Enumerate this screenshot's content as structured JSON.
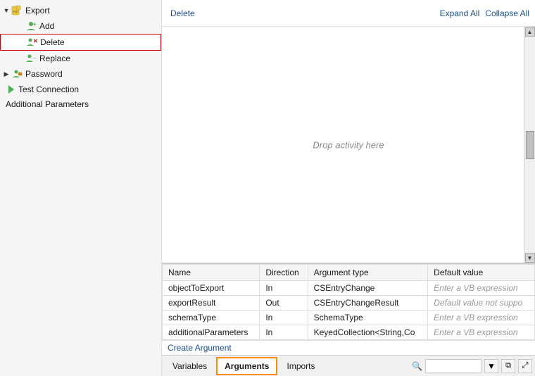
{
  "sidebar": {
    "items": [
      {
        "id": "export",
        "label": "Export",
        "indent": 0,
        "has_chevron": true,
        "chevron_open": true,
        "icon": "export-icon"
      },
      {
        "id": "add",
        "label": "Add",
        "indent": 1,
        "has_chevron": false,
        "icon": "add-icon"
      },
      {
        "id": "delete",
        "label": "Delete",
        "indent": 1,
        "has_chevron": false,
        "icon": "delete-icon",
        "selected": true
      },
      {
        "id": "replace",
        "label": "Replace",
        "indent": 1,
        "has_chevron": false,
        "icon": "replace-icon"
      },
      {
        "id": "password",
        "label": "Password",
        "indent": 0,
        "has_chevron": true,
        "chevron_open": false,
        "icon": "password-icon"
      },
      {
        "id": "test-connection",
        "label": "Test Connection",
        "indent": 0,
        "has_chevron": false,
        "icon": "testconn-icon"
      },
      {
        "id": "additional-parameters",
        "label": "Additional Parameters",
        "indent": 0,
        "has_chevron": false,
        "icon": "params-icon"
      }
    ]
  },
  "top_bar": {
    "delete_label": "Delete",
    "expand_all_label": "Expand All",
    "collapse_all_label": "Collapse All"
  },
  "designer": {
    "drop_hint": "Drop activity here"
  },
  "arguments_table": {
    "columns": [
      "Name",
      "Direction",
      "Argument type",
      "Default value"
    ],
    "rows": [
      {
        "name": "objectToExport",
        "direction": "In",
        "argument_type": "CSEntryChange",
        "default_value": "",
        "default_placeholder": "Enter a VB expression"
      },
      {
        "name": "exportResult",
        "direction": "Out",
        "argument_type": "CSEntryChangeResult",
        "default_value": "",
        "default_placeholder": "Default value not suppo"
      },
      {
        "name": "schemaType",
        "direction": "In",
        "argument_type": "SchemaType",
        "default_value": "",
        "default_placeholder": "Enter a VB expression"
      },
      {
        "name": "additionalParameters",
        "direction": "In",
        "argument_type": "KeyedCollection<String,Co",
        "default_value": "",
        "default_placeholder": "Enter a VB expression"
      }
    ],
    "create_arg_label": "Create Argument"
  },
  "bottom_tabs": {
    "tabs": [
      {
        "id": "variables",
        "label": "Variables"
      },
      {
        "id": "arguments",
        "label": "Arguments",
        "active": true
      },
      {
        "id": "imports",
        "label": "Imports"
      }
    ],
    "search_placeholder": ""
  }
}
